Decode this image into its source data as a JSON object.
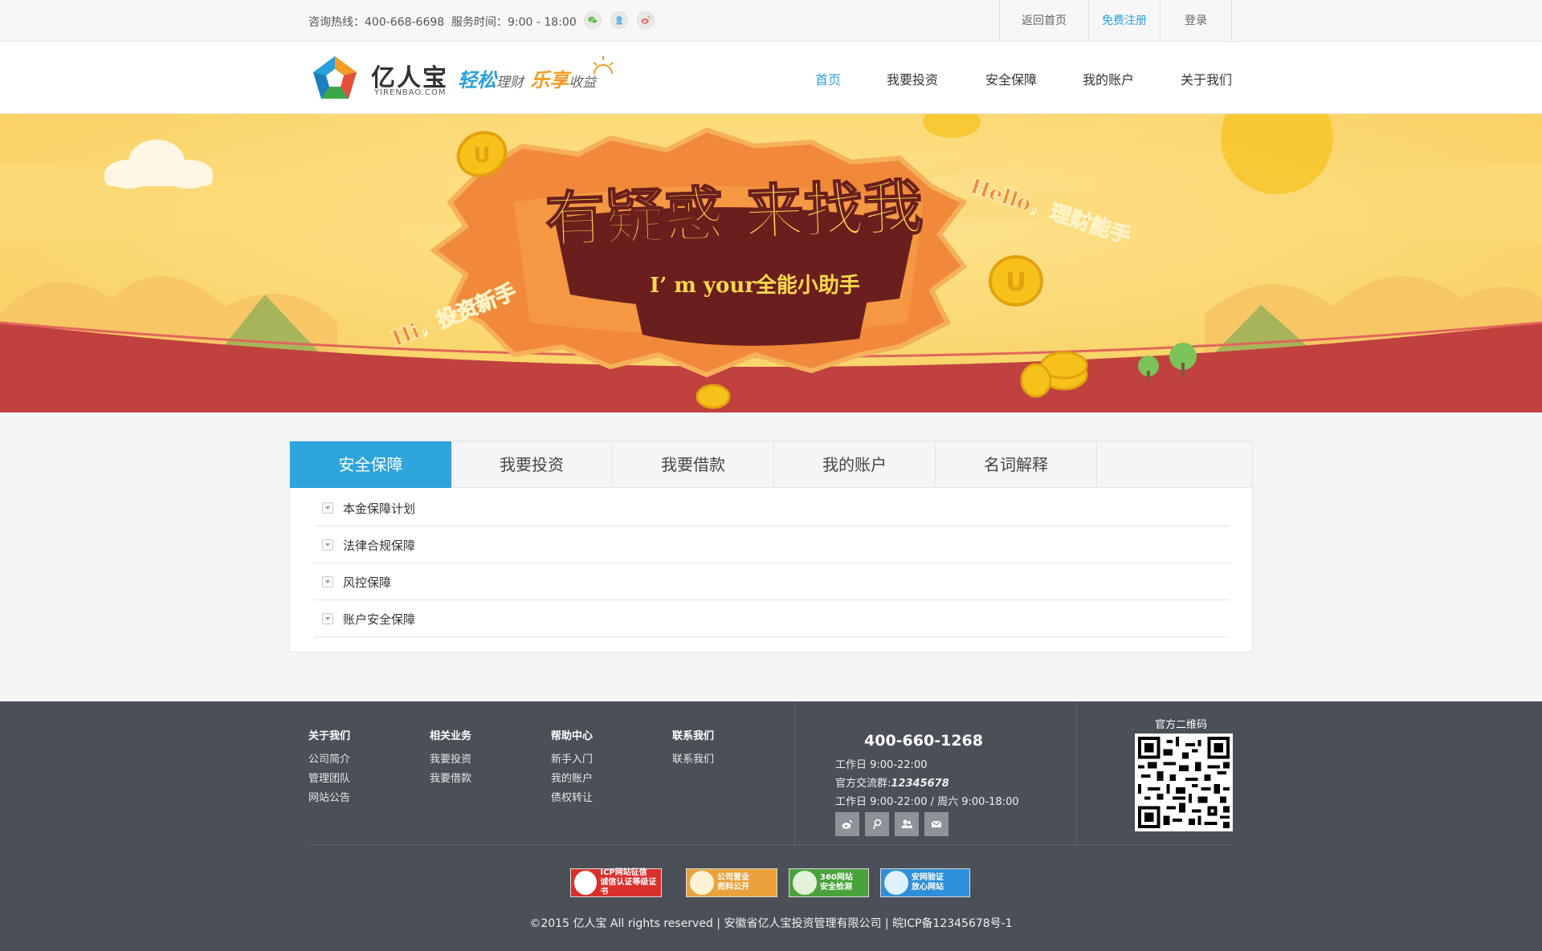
{
  "topbar": {
    "hotline": "咨询热线：400-668-6698",
    "hours": "服务时间：9:00 - 18:00",
    "social_icons": [
      "wechat-icon",
      "qq-icon",
      "weibo-icon"
    ],
    "links": [
      "返回首页",
      "免费注册",
      "登录"
    ]
  },
  "header": {
    "logo_name": "亿人宝",
    "logo_en": "YIRENBAO.COM",
    "slogan": {
      "a": "轻松",
      "b": "理财",
      "c": "乐享",
      "d": "收益"
    },
    "nav": [
      "首页",
      "我要投资",
      "安全保障",
      "我的账户",
      "关于我们"
    ],
    "active_nav": "首页"
  },
  "banner": {
    "headline": "有疑惑 来找我",
    "subline": "I’ m your全能小助手",
    "left_tag": "Hi，投资新手",
    "right_tag": "Hello，理财能手",
    "colors": {
      "sky": "#fbd870",
      "ground": "#c0413d",
      "accent": "#f08a3a",
      "plate": "#6b1f1d"
    }
  },
  "panel": {
    "tabs": [
      "安全保障",
      "我要投资",
      "我要借款",
      "我的账户",
      "名词解释"
    ],
    "active_tab": "安全保障",
    "items": [
      "本金保障计划",
      "法律合规保障",
      "风控保障",
      "账户安全保障"
    ]
  },
  "footer": {
    "columns": [
      {
        "title": "关于我们",
        "links": [
          "公司简介",
          "管理团队",
          "网站公告"
        ]
      },
      {
        "title": "相关业务",
        "links": [
          "我要投资",
          "我要借款"
        ]
      },
      {
        "title": "帮助中心",
        "links": [
          "新手入门",
          "我的账户",
          "债权转让"
        ]
      },
      {
        "title": "联系我们",
        "links": [
          "联系我们"
        ]
      }
    ],
    "phone": "400-660-1268",
    "work_hours": "工作日 9:00-22:00",
    "group_label": "官方交流群:",
    "group_number": "12345678",
    "work_hours_full": "工作日 9:00-22:00 / 周六 9:00-18:00",
    "social_icons": [
      "weibo-icon",
      "tencent-weibo-icon",
      "users-icon",
      "mail-icon"
    ],
    "qr_title": "官方二维码",
    "badges": [
      {
        "line1": "ICP网站征信",
        "line2": "诚信认证等级证书",
        "color": "#d9302c"
      },
      {
        "line1": "公司营业",
        "line2": "资料公开",
        "color": "#e9a23b"
      },
      {
        "line1": "360网站",
        "line2": "安全检测",
        "color": "#4aa23c"
      },
      {
        "line1": "安网验证",
        "line2": "放心网站",
        "color": "#2f8fd8"
      }
    ],
    "copyright": "©2015 亿人宝 All rights reserved  |  安徽省亿人宝投资管理有限公司  |  皖ICP备12345678号-1"
  }
}
